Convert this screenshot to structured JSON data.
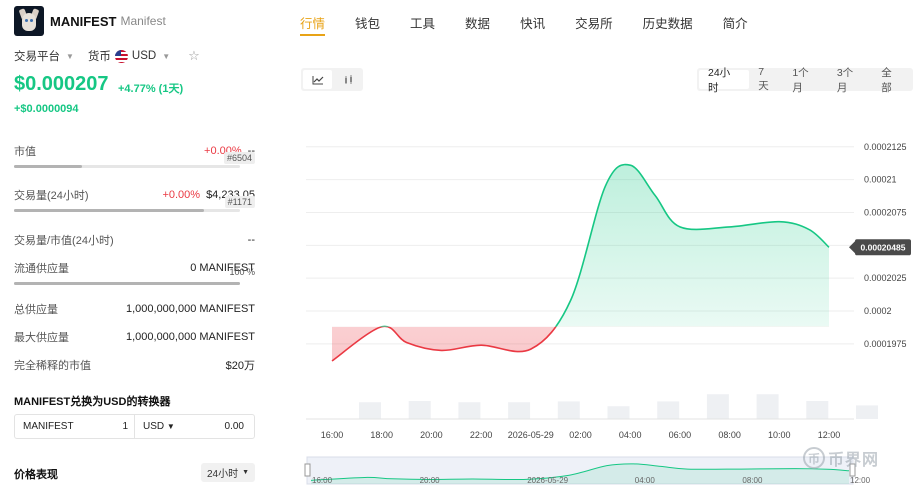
{
  "coin": {
    "symbol": "MANIFEST",
    "name": "Manifest"
  },
  "selectors": {
    "platform_label": "交易平台",
    "currency_label": "货币",
    "currency_value": "USD"
  },
  "price": {
    "value": "$0.000207",
    "change_pct": "+4.77% (1天)",
    "change_abs": "+$0.0000094"
  },
  "stats": {
    "market_cap": {
      "label": "市值",
      "change": "+0.00%",
      "value": "--",
      "rank": "#6504",
      "bar_fraction": 0.3
    },
    "volume_24h": {
      "label": "交易量(24小时)",
      "change": "+0.00%",
      "value": "$4,233.05",
      "rank": "#1171",
      "bar_fraction": 0.84
    },
    "vol_mcap": {
      "label": "交易量/市值(24小时)",
      "value": "--"
    },
    "circulating": {
      "label": "流通供应量",
      "value": "0 MANIFEST",
      "percent": "100 %",
      "bar_fraction": 1.0
    },
    "total_supply": {
      "label": "总供应量",
      "value": "1,000,000,000 MANIFEST"
    },
    "max_supply": {
      "label": "最大供应量",
      "value": "1,000,000,000 MANIFEST"
    },
    "fdv": {
      "label": "完全稀释的市值",
      "value": "$20万"
    }
  },
  "converter": {
    "title": "MANIFEST兑换为USD的转换器",
    "from_symbol": "MANIFEST",
    "from_value": "1",
    "to_symbol": "USD",
    "to_value": "0.00"
  },
  "performance": {
    "title": "价格表现",
    "range": "24小时"
  },
  "tabs": [
    "行情",
    "钱包",
    "工具",
    "数据",
    "快讯",
    "交易所",
    "历史数据",
    "简介"
  ],
  "chart_controls": {
    "ranges": [
      "24小时",
      "7天",
      "1个月",
      "3个月",
      "全部"
    ],
    "active_range": "24小时"
  },
  "watermark": {
    "text": "币界网"
  },
  "chart_data": {
    "type": "area",
    "x": [
      "16:00",
      "18:00",
      "20:00",
      "22:00",
      "2026-05-29",
      "02:00",
      "04:00",
      "06:00",
      "08:00",
      "10:00",
      "12:00"
    ],
    "y_ticks": [
      "0.0002125",
      "0.00021",
      "0.0002075",
      "0.000205",
      "0.0002025",
      "0.0002",
      "0.0001975"
    ],
    "ylim": [
      0.0001965,
      0.0002137
    ],
    "baseline": 0.0001988,
    "current_value": "0.00020485",
    "series": [
      {
        "points": [
          [
            0,
            0.0001962
          ],
          [
            1.0,
            0.0001988
          ],
          [
            1.5,
            0.0001976
          ],
          [
            2.2,
            0.000197
          ],
          [
            3.0,
            0.0001974
          ],
          [
            4.0,
            0.0001971
          ],
          [
            4.8,
            0.0002008
          ],
          [
            5.5,
            0.0002095
          ],
          [
            6.0,
            0.0002111
          ],
          [
            6.5,
            0.0002088
          ],
          [
            7.0,
            0.0002064
          ],
          [
            8.0,
            0.0002064
          ],
          [
            9.0,
            0.0002068
          ],
          [
            9.6,
            0.0002062
          ],
          [
            10.0,
            0.00020485
          ]
        ]
      }
    ],
    "volume": [
      0.42,
      0.45,
      0.42,
      0.42,
      0.44,
      0.32,
      0.44,
      0.62,
      0.62,
      0.45,
      0.34
    ],
    "navigator_labels": [
      "16:00",
      "20:00",
      "2026-05-29",
      "04:00",
      "08:00",
      "12:00"
    ]
  }
}
